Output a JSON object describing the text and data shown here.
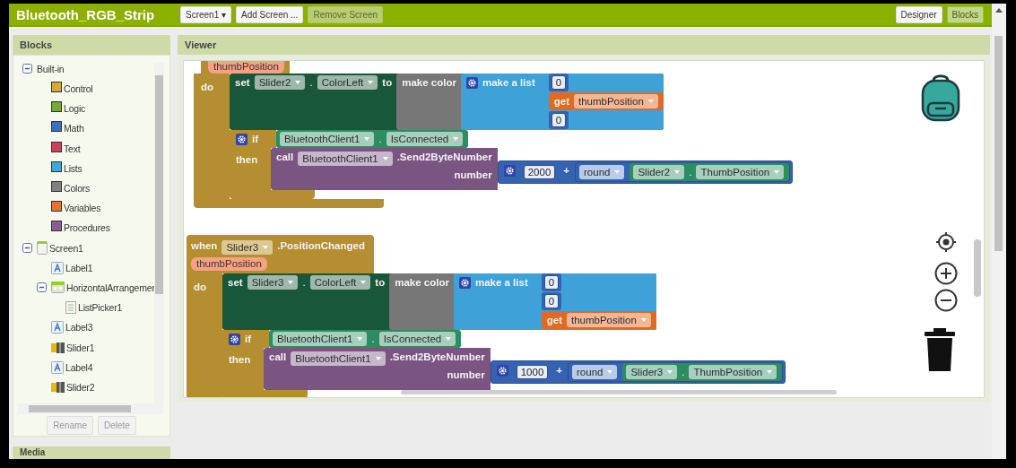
{
  "topbar": {
    "title": "Bluetooth_RGB_Strip",
    "screen_menu": {
      "label": "Screen1",
      "caret": "▾"
    },
    "buttons": [
      {
        "label": "Add Screen ...",
        "disabled": false
      },
      {
        "label": "Remove Screen",
        "disabled": true
      }
    ],
    "views": [
      {
        "label": "Designer",
        "selected": false
      },
      {
        "label": "Blocks",
        "selected": true
      }
    ]
  },
  "sidebar": {
    "title": "Blocks",
    "tree": [
      {
        "label": "Built-in",
        "kind": "folder",
        "expanded": true,
        "children": [
          {
            "label": "Control",
            "kind": "category",
            "color": "#d8a836"
          },
          {
            "label": "Logic",
            "kind": "category",
            "color": "#76a83c"
          },
          {
            "label": "Math",
            "kind": "category",
            "color": "#3b6fbf"
          },
          {
            "label": "Text",
            "kind": "category",
            "color": "#c9435f"
          },
          {
            "label": "Lists",
            "kind": "category",
            "color": "#40a6dd"
          },
          {
            "label": "Colors",
            "kind": "category",
            "color": "#808080"
          },
          {
            "label": "Variables",
            "kind": "category",
            "color": "#e37333"
          },
          {
            "label": "Procedures",
            "kind": "category",
            "color": "#8a5d94"
          }
        ]
      },
      {
        "label": "Screen1",
        "kind": "screen",
        "expanded": true,
        "children": [
          {
            "label": "Label1",
            "kind": "label"
          },
          {
            "label": "HorizontalArrangemer",
            "kind": "arrangement",
            "expanded": true,
            "children": [
              {
                "label": "ListPicker1",
                "kind": "listpicker"
              }
            ]
          },
          {
            "label": "Label3",
            "kind": "label"
          },
          {
            "label": "Slider1",
            "kind": "slider"
          },
          {
            "label": "Label4",
            "kind": "label"
          },
          {
            "label": "Slider2",
            "kind": "slider"
          }
        ]
      }
    ],
    "buttons": [
      {
        "label": "Rename",
        "disabled": true
      },
      {
        "label": "Delete",
        "disabled": true
      }
    ],
    "next_panel": "Media"
  },
  "viewer": {
    "title": "Viewer",
    "blocks": [
      {
        "kind": "event",
        "param": "thumbPosition",
        "do": "do",
        "body": [
          {
            "kind": "set",
            "label": "set",
            "component": "Slider2",
            "dot": ".",
            "property": "ColorLeft",
            "to": "to",
            "value": {
              "kind": "make_color",
              "label": "make color",
              "value": {
                "kind": "make_list",
                "label": "make a list",
                "items": [
                  {
                    "kind": "number",
                    "value": "0"
                  },
                  {
                    "kind": "get",
                    "label": "get",
                    "variable": "thumbPosition"
                  },
                  {
                    "kind": "number",
                    "value": "0"
                  }
                ]
              }
            }
          },
          {
            "kind": "if",
            "if": "if",
            "then": "then",
            "condition": {
              "kind": "getter",
              "component": "BluetoothClient1",
              "dot": ".",
              "property": "IsConnected"
            },
            "body": [
              {
                "kind": "call",
                "label": "call",
                "component": "BluetoothClient1",
                "method": ".Send2ByteNumber",
                "arg": "number",
                "value": {
                  "kind": "add",
                  "op": "+",
                  "items": [
                    {
                      "kind": "number",
                      "value": "2000"
                    },
                    {
                      "kind": "round",
                      "op": "round",
                      "value": {
                        "kind": "getter",
                        "component": "Slider2",
                        "dot": ".",
                        "property": "ThumbPosition"
                      }
                    }
                  ]
                }
              }
            ]
          }
        ]
      },
      {
        "kind": "event",
        "when": "when",
        "component": "Slider3",
        "event": ".PositionChanged",
        "param": "thumbPosition",
        "do": "do",
        "body": [
          {
            "kind": "set",
            "label": "set",
            "component": "Slider3",
            "dot": ".",
            "property": "ColorLeft",
            "to": "to",
            "value": {
              "kind": "make_color",
              "label": "make color",
              "value": {
                "kind": "make_list",
                "label": "make a list",
                "items": [
                  {
                    "kind": "number",
                    "value": "0"
                  },
                  {
                    "kind": "number",
                    "value": "0"
                  },
                  {
                    "kind": "get",
                    "label": "get",
                    "variable": "thumbPosition"
                  }
                ]
              }
            }
          },
          {
            "kind": "if",
            "if": "if",
            "then": "then",
            "condition": {
              "kind": "getter",
              "component": "BluetoothClient1",
              "dot": ".",
              "property": "IsConnected"
            },
            "body": [
              {
                "kind": "call",
                "label": "call",
                "component": "BluetoothClient1",
                "method": ".Send2ByteNumber",
                "arg": "number",
                "value": {
                  "kind": "add",
                  "op": "+",
                  "items": [
                    {
                      "kind": "number",
                      "value": "1000"
                    },
                    {
                      "kind": "round",
                      "op": "round",
                      "value": {
                        "kind": "getter",
                        "component": "Slider3",
                        "dot": ".",
                        "property": "ThumbPosition"
                      }
                    }
                  ]
                }
              }
            ]
          }
        ]
      }
    ]
  }
}
